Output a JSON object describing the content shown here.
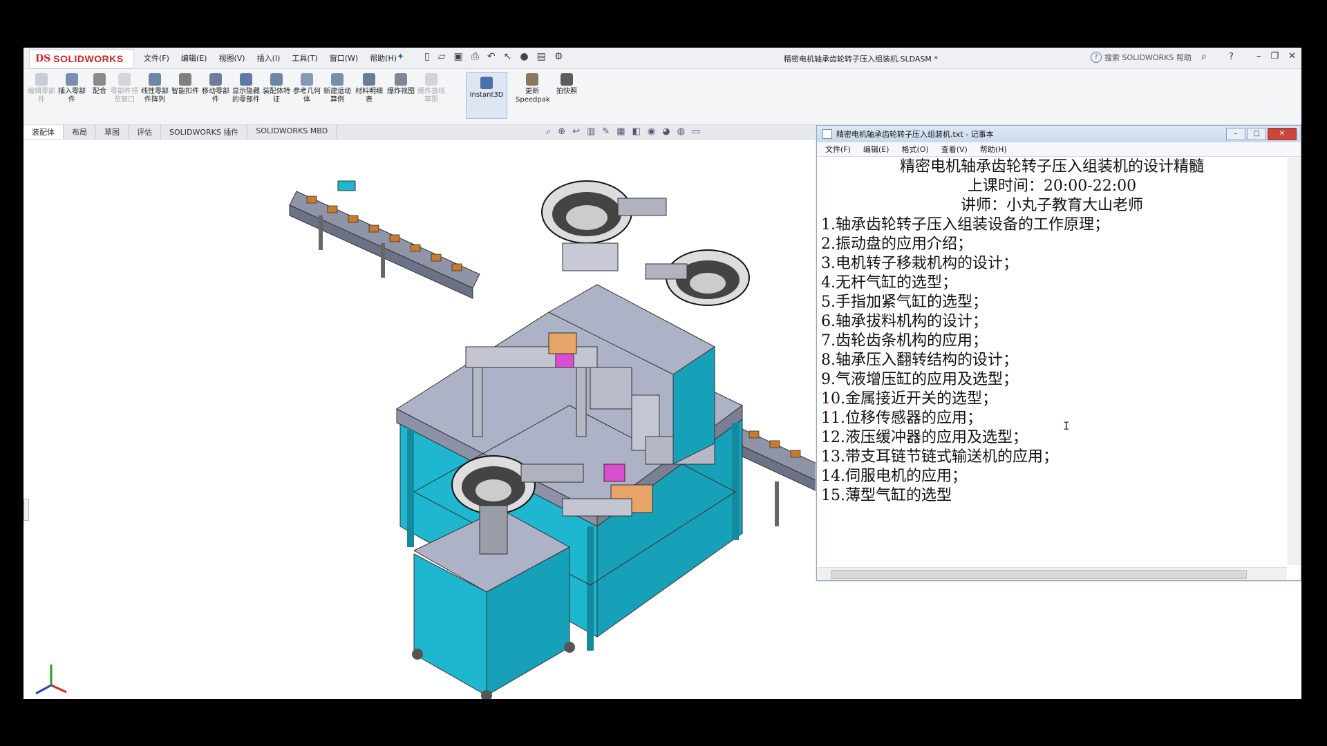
{
  "app": {
    "logo_mark": "DS",
    "logo_text": "SOLIDWORKS",
    "menus": [
      "文件(F)",
      "编辑(E)",
      "视图(V)",
      "插入(I)",
      "工具(T)",
      "窗口(W)",
      "帮助(H)"
    ],
    "document_title": "精密电机轴承齿轮转子压入组装机.SLDASM *",
    "search_placeholder": "搜索 SOLIDWORKS 帮助",
    "help_label": "?"
  },
  "toolbar": {
    "items": [
      {
        "label": "编辑零部件",
        "disabled": true
      },
      {
        "label": "插入零部件",
        "disabled": false
      },
      {
        "label": "配合",
        "disabled": false
      },
      {
        "label": "零部件预览窗口",
        "disabled": true
      },
      {
        "label": "线性零部件阵列",
        "disabled": false
      },
      {
        "label": "智能扣件",
        "disabled": false
      },
      {
        "label": "移动零部件",
        "disabled": false
      },
      {
        "label": "显示隐藏的零部件",
        "disabled": false
      },
      {
        "label": "装配体特征",
        "disabled": false
      },
      {
        "label": "参考几何体",
        "disabled": false
      },
      {
        "label": "新建运动算例",
        "disabled": false
      },
      {
        "label": "材料明细表",
        "disabled": false
      },
      {
        "label": "爆炸视图",
        "disabled": false
      },
      {
        "label": "爆炸直线草图",
        "disabled": true
      },
      {
        "label": "Instant3D",
        "disabled": false,
        "active": true
      },
      {
        "label": "更新Speedpak",
        "disabled": false
      },
      {
        "label": "拍快照",
        "disabled": false
      }
    ]
  },
  "tabs": [
    "装配体",
    "布局",
    "草图",
    "评估",
    "SOLIDWORKS 插件",
    "SOLIDWORKS MBD"
  ],
  "notepad": {
    "title": "精密电机轴承齿轮转子压入组装机.txt - 记事本",
    "menus": [
      "文件(F)",
      "编辑(E)",
      "格式(O)",
      "查看(V)",
      "帮助(H)"
    ],
    "heading": "精密电机轴承齿轮转子压入组装机的设计精髓",
    "time": "上课时间：20:00-22:00",
    "teacher": "讲师：小丸子教育大山老师",
    "items": [
      "1.轴承齿轮转子压入组装设备的工作原理；",
      "2.振动盘的应用介绍；",
      "3.电机转子移栽机构的设计；",
      "4.无杆气缸的选型；",
      "5.手指加紧气缸的选型；",
      "6.轴承拔料机构的设计；",
      "7.齿轮齿条机构的应用；",
      "8.轴承压入翻转结构的设计；",
      "9.气液增压缸的应用及选型；",
      "10.金属接近开关的选型；",
      "11.位移传感器的应用；",
      "12.液压缓冲器的应用及选型；",
      "13.带支耳链节链式输送机的应用；",
      "14.伺服电机的应用；",
      "15.薄型气缸的选型"
    ]
  },
  "colors": {
    "frame_teal": "#1fb6cf",
    "table_top": "#aeb2c6",
    "accent_orange": "#e8a568"
  }
}
